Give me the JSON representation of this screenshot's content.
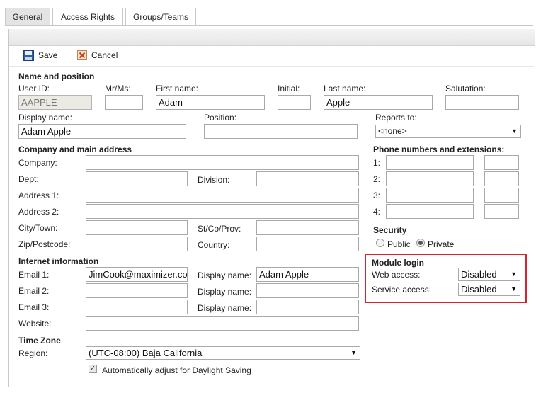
{
  "tabs": [
    "General",
    "Access Rights",
    "Groups/Teams"
  ],
  "toolbar": {
    "save_label": "Save",
    "cancel_label": "Cancel"
  },
  "name_position": {
    "heading": "Name and position",
    "user_id_label": "User ID:",
    "user_id_value": "AAPPLE",
    "mr_ms_label": "Mr/Ms:",
    "mr_ms_value": "",
    "first_name_label": "First name:",
    "first_name_value": "Adam",
    "initial_label": "Initial:",
    "initial_value": "",
    "last_name_label": "Last name:",
    "last_name_value": "Apple",
    "salutation_label": "Salutation:",
    "salutation_value": "",
    "display_name_label": "Display name:",
    "display_name_value": "Adam Apple",
    "position_label": "Position:",
    "position_value": "",
    "reports_to_label": "Reports to:",
    "reports_to_value": "<none>"
  },
  "company": {
    "heading": "Company and main address",
    "company_label": "Company:",
    "dept_label": "Dept:",
    "division_label": "Division:",
    "address1_label": "Address 1:",
    "address2_label": "Address 2:",
    "city_label": "City/Town:",
    "stcoprov_label": "St/Co/Prov:",
    "zip_label": "Zip/Postcode:",
    "country_label": "Country:"
  },
  "phones": {
    "heading": "Phone numbers and extensions:",
    "labels": [
      "1:",
      "2:",
      "3:",
      "4:"
    ]
  },
  "security": {
    "heading": "Security",
    "public_label": "Public",
    "private_label": "Private",
    "selected": "Private"
  },
  "internet": {
    "heading": "Internet information",
    "email1_label": "Email 1:",
    "email1_value": "JimCook@maximizer.com",
    "email2_label": "Email 2:",
    "email3_label": "Email 3:",
    "display_name_label": "Display name:",
    "display_name1_value": "Adam Apple",
    "website_label": "Website:"
  },
  "module_login": {
    "heading": "Module login",
    "web_access_label": "Web access:",
    "web_access_value": "Disabled",
    "service_access_label": "Service access:",
    "service_access_value": "Disabled",
    "highlight_color": "#d9232e"
  },
  "time_zone": {
    "heading": "Time Zone",
    "region_label": "Region:",
    "region_value": "(UTC-08:00) Baja California",
    "dst_label": "Automatically adjust for Daylight Saving",
    "dst_checked": true
  }
}
